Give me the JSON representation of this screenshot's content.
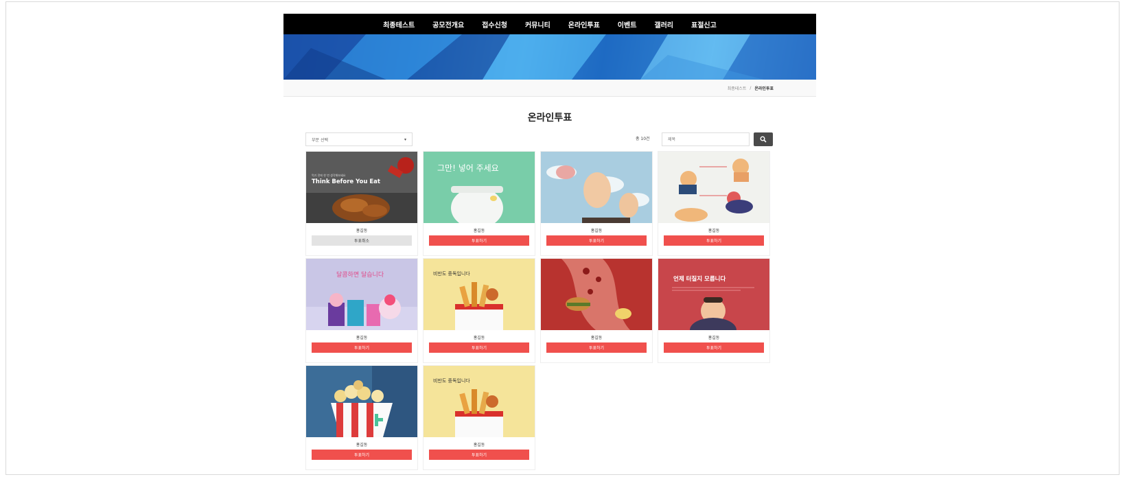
{
  "nav": {
    "items": [
      "최종테스트",
      "공모전개요",
      "접수신청",
      "커뮤니티",
      "온라인투표",
      "이벤트",
      "갤러리",
      "표절신고"
    ]
  },
  "breadcrumb": {
    "home": "최종테스트",
    "separator": "/",
    "current": "온라인투표"
  },
  "page": {
    "title": "온라인투표"
  },
  "filter": {
    "select_value": "부문 선택",
    "caret": "▾",
    "count_text": "총 10건",
    "search_placeholder": "제목"
  },
  "cards": [
    {
      "label": "홍길동",
      "button": "투표취소",
      "voted": true,
      "image": "food-think-before-you-eat",
      "overlay_small": "먹기 전에 한 번 생각해보세요",
      "overlay_title": "Think Before You Eat"
    },
    {
      "label": "홍길동",
      "button": "투표하기",
      "voted": false,
      "image": "rice-pot",
      "overlay_title": "그만! 넣어 주세요"
    },
    {
      "label": "홍길동",
      "button": "투표하기",
      "voted": false,
      "image": "fat-clouds",
      "overlay_title": ""
    },
    {
      "label": "홍길동",
      "button": "투표하기",
      "voted": false,
      "image": "exercise-people",
      "overlay_title": ""
    },
    {
      "label": "홍길동",
      "button": "투표하기",
      "voted": false,
      "image": "cupcakes",
      "overlay_title": "달콤하면 달습니다"
    },
    {
      "label": "홍길동",
      "button": "투표하기",
      "voted": false,
      "image": "fried-food",
      "overlay_title": "비만도 중독입니다"
    },
    {
      "label": "홍길동",
      "button": "투표하기",
      "voted": false,
      "image": "burger-artery",
      "overlay_title": ""
    },
    {
      "label": "홍길동",
      "button": "투표하기",
      "voted": false,
      "image": "bloated-man",
      "overlay_title": "언제 터질지 모릅니다"
    },
    {
      "label": "홍길동",
      "button": "투표하기",
      "voted": false,
      "image": "popcorn",
      "overlay_title": ""
    },
    {
      "label": "홍길동",
      "button": "투표하기",
      "voted": false,
      "image": "fried-food",
      "overlay_title": "비만도 중독입니다"
    }
  ],
  "colors": {
    "vote": "#f0504d",
    "cancel": "#e3e3e3",
    "nav_bg": "#000000"
  }
}
